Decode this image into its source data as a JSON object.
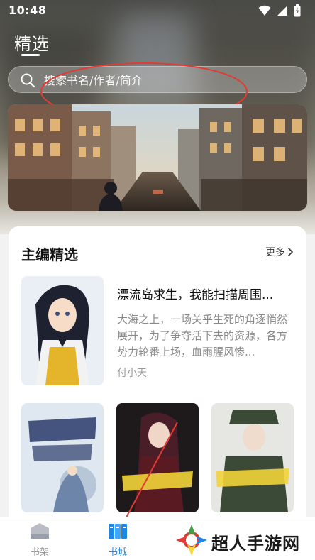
{
  "status": {
    "time": "10:48"
  },
  "header": {
    "title": "精选"
  },
  "search": {
    "placeholder": "搜索书名/作者/简介"
  },
  "section": {
    "title": "主编精选",
    "more_label": "更多"
  },
  "featured": {
    "title": "漂流岛求生，我能扫描周围...",
    "description": "大海之上，一场关乎生死的角逐悄然展开，为了争夺活下去的资源，各方势力轮番上场，血雨腥风惨...",
    "author": "付小天"
  },
  "tabs": [
    {
      "label": "书架",
      "icon": "bookshelf-icon",
      "active": false
    },
    {
      "label": "书城",
      "icon": "bookstore-icon",
      "active": true
    }
  ],
  "watermark": {
    "text": "超人手游网"
  },
  "colors": {
    "accent": "#1e88e5",
    "tab_inactive": "#999999",
    "annotation": "#e53935"
  }
}
